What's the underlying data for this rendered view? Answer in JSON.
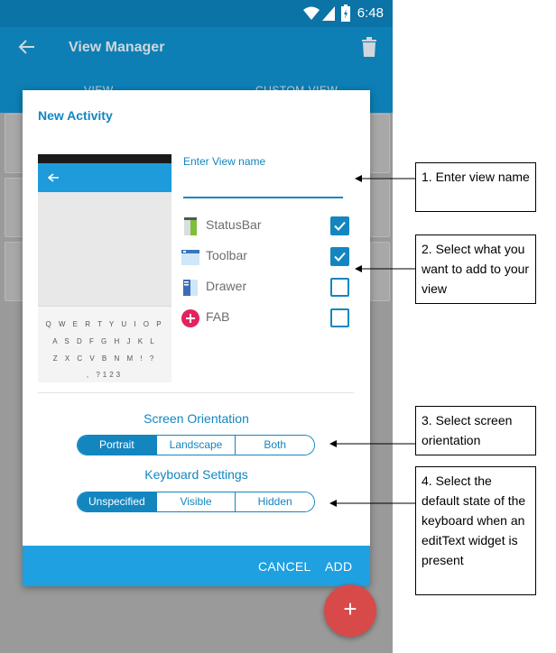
{
  "statusbar": {
    "time": "6:48"
  },
  "appbar": {
    "title": "View Manager"
  },
  "tabs": [
    {
      "label": "VIEW"
    },
    {
      "label": "CUSTOM VIEW"
    }
  ],
  "dialog": {
    "title": "New Activity",
    "name_label": "Enter View name",
    "name_value": "",
    "options": [
      {
        "label": "StatusBar",
        "checked": true,
        "icon": "statusbar-icon"
      },
      {
        "label": "Toolbar",
        "checked": true,
        "icon": "toolbar-icon"
      },
      {
        "label": "Drawer",
        "checked": false,
        "icon": "drawer-icon"
      },
      {
        "label": "FAB",
        "checked": false,
        "icon": "fab-icon"
      }
    ],
    "orientation": {
      "label": "Screen Orientation",
      "options": [
        "Portrait",
        "Landscape",
        "Both"
      ],
      "selected": "Portrait"
    },
    "keyboard": {
      "label": "Keyboard Settings",
      "options": [
        "Unspecified",
        "Visible",
        "Hidden"
      ],
      "selected": "Unspecified"
    },
    "cancel_label": "CANCEL",
    "add_label": "ADD"
  },
  "preview": {
    "kbd_rows": [
      "Q W E R T Y U I O P",
      "A S D F G H J K L",
      "Z X C V B N M ! ?",
      ",  ?123"
    ]
  },
  "fab": {
    "label": "+"
  },
  "callouts": [
    {
      "text": "1. Enter view name"
    },
    {
      "text": "2. Select what you want to add to your view"
    },
    {
      "text": "3. Select screen orientation"
    },
    {
      "text": "4. Select the default state of the keyboard when an editText widget is present"
    }
  ],
  "colors": {
    "accent": "#1386c0",
    "appbar": "#0d7fb5",
    "footer": "#1ea0e1",
    "fab": "#d84a4a"
  }
}
